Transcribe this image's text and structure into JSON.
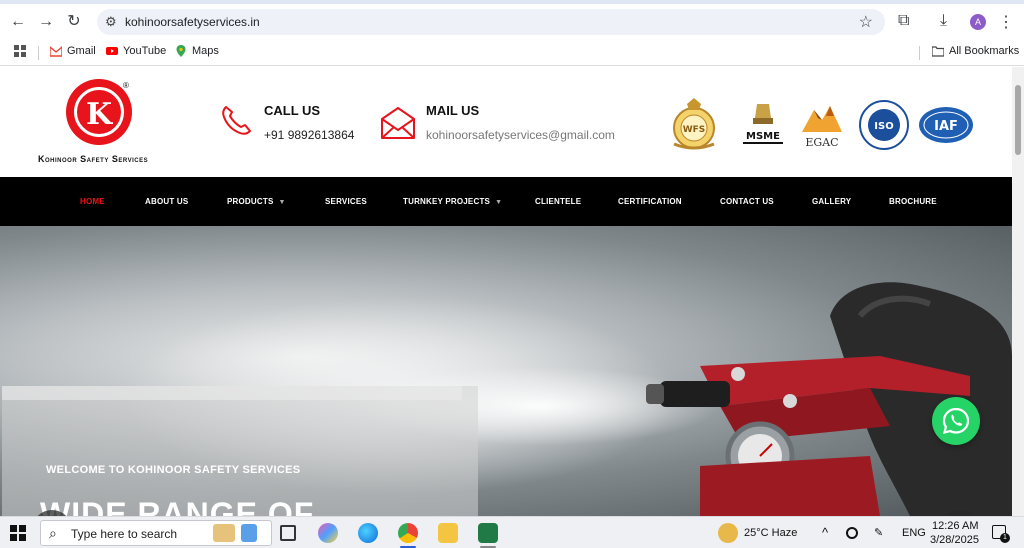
{
  "browser": {
    "url": "kohinoorsafetyservices.in",
    "bookmarks": [
      {
        "label": "Gmail"
      },
      {
        "label": "YouTube"
      },
      {
        "label": "Maps"
      }
    ],
    "all_bookmarks": "All Bookmarks",
    "profile_initial": "A"
  },
  "site": {
    "brand_name": "Kohinoor Safety Services",
    "logo_letter": "K",
    "registered_mark": "®",
    "call": {
      "title": "CALL US",
      "value": "+91 9892613864"
    },
    "mail": {
      "title": "MAIL US",
      "value": "kohinoorsafetyservices@gmail.com"
    },
    "cert_logos": [
      {
        "name": "wfs-seal",
        "text": "WFS"
      },
      {
        "name": "msme-emblem",
        "text": "MSME"
      },
      {
        "name": "egac-logo",
        "text": "EGAC"
      },
      {
        "name": "iso-badge",
        "text": "ISO"
      },
      {
        "name": "iaf-logo",
        "text": "IAF"
      }
    ],
    "nav": [
      {
        "label": "HOME",
        "active": true
      },
      {
        "label": "ABOUT US"
      },
      {
        "label": "PRODUCTS",
        "dropdown": true
      },
      {
        "label": "SERVICES"
      },
      {
        "label": "TURNKEY PROJECTS",
        "dropdown": true
      },
      {
        "label": "CLIENTELE"
      },
      {
        "label": "CERTIFICATION"
      },
      {
        "label": "CONTACT US"
      },
      {
        "label": "GALLERY"
      },
      {
        "label": "BROCHURE"
      }
    ],
    "hero": {
      "welcome": "WELCOME TO KOHINOOR SAFETY SERVICES",
      "headline": "WIDE RANGE OF"
    }
  },
  "taskbar": {
    "search_placeholder": "Type here to search",
    "weather": "25°C  Haze",
    "lang": "ENG",
    "time": "12:26 AM",
    "date": "3/28/2025",
    "notifications": "1"
  },
  "colors": {
    "brand_red": "#e8141b",
    "nav_bg": "#000000",
    "whatsapp": "#25d366",
    "accent_green": "#3fb34f"
  }
}
